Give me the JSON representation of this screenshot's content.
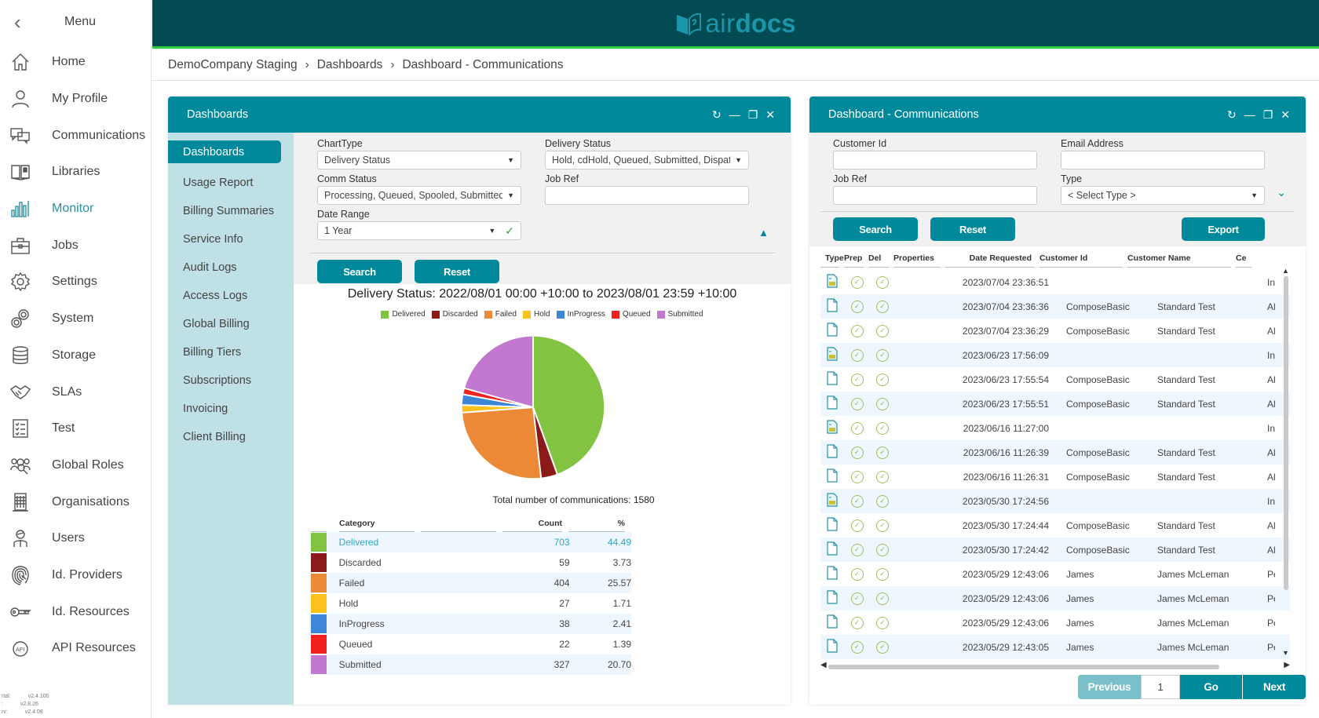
{
  "nav": {
    "menu_label": "Menu",
    "items": [
      {
        "label": "Home",
        "icon": "home-icon"
      },
      {
        "label": "My Profile",
        "icon": "profile-icon"
      },
      {
        "label": "Communications",
        "icon": "communications-icon"
      },
      {
        "label": "Libraries",
        "icon": "libraries-icon"
      },
      {
        "label": "Monitor",
        "icon": "monitor-icon",
        "active": true
      },
      {
        "label": "Jobs",
        "icon": "briefcase-icon"
      },
      {
        "label": "Settings",
        "icon": "gear-icon"
      },
      {
        "label": "System",
        "icon": "gears-icon"
      },
      {
        "label": "Storage",
        "icon": "database-icon"
      },
      {
        "label": "SLAs",
        "icon": "handshake-icon"
      },
      {
        "label": "Test",
        "icon": "checklist-icon"
      },
      {
        "label": "Global Roles",
        "icon": "roles-icon"
      },
      {
        "label": "Organisations",
        "icon": "building-icon"
      },
      {
        "label": "Users",
        "icon": "user-icon"
      },
      {
        "label": "Id. Providers",
        "icon": "fingerprint-icon"
      },
      {
        "label": "Id. Resources",
        "icon": "key-icon"
      },
      {
        "label": "API Resources",
        "icon": "api-icon"
      }
    ],
    "versions": [
      {
        "label": "rtal:",
        "value": "v2.4.100"
      },
      {
        "label": ":",
        "value": "v2.8.26"
      },
      {
        "label": "rv:",
        "value": "v2.4.08"
      }
    ]
  },
  "header": {
    "logo_part1": "air",
    "logo_part2": "docs",
    "brand_color": "#1a96ab",
    "bar_color": "#024b53",
    "accent_line": "#2ecc40"
  },
  "breadcrumb": [
    "DemoCompany Staging",
    "Dashboards",
    "Dashboard - Communications"
  ],
  "dashboards_panel": {
    "title": "Dashboards",
    "side_items": [
      "Dashboards",
      "Usage Report",
      "Billing Summaries",
      "Service Info",
      "Audit Logs",
      "Access Logs",
      "Global Billing",
      "Billing Tiers",
      "Subscriptions",
      "Invoicing",
      "Client Billing"
    ],
    "form": {
      "chart_type_label": "ChartType",
      "chart_type_value": "Delivery Status",
      "delivery_status_label": "Delivery Status",
      "delivery_status_value": "Hold, cdHold, Queued, Submitted, Dispatcl",
      "comm_status_label": "Comm Status",
      "comm_status_value": "Processing, Queued, Spooled, Submitted, H",
      "job_ref_label": "Job Ref",
      "job_ref_value": "",
      "date_range_label": "Date Range",
      "date_range_value": "1 Year"
    },
    "search_label": "Search",
    "reset_label": "Reset",
    "total_text": "Total number of communications: 1580",
    "table_headers": {
      "category": "Category",
      "count": "Count",
      "pct": "%"
    }
  },
  "chart_data": {
    "type": "pie",
    "title": "Delivery Status: 2022/08/01 00:00 +10:00 to 2023/08/01 23:59 +10:00",
    "legend_position": "top",
    "total": 1580,
    "slices": [
      {
        "label": "Delivered",
        "value": 703,
        "percent": 44.49,
        "color": "#82c341"
      },
      {
        "label": "Discarded",
        "value": 59,
        "percent": 3.73,
        "color": "#8b1a1a"
      },
      {
        "label": "Failed",
        "value": 404,
        "percent": 25.57,
        "color": "#ec8936"
      },
      {
        "label": "Hold",
        "value": 27,
        "percent": 1.71,
        "color": "#fcc21b"
      },
      {
        "label": "InProgress",
        "value": 38,
        "percent": 2.41,
        "color": "#3d85d6"
      },
      {
        "label": "Queued",
        "value": 22,
        "percent": 1.39,
        "color": "#f0211f"
      },
      {
        "label": "Submitted",
        "value": 327,
        "percent": 20.7,
        "color": "#c278cf"
      }
    ]
  },
  "comms_panel": {
    "title": "Dashboard - Communications",
    "form": {
      "customer_id_label": "Customer Id",
      "customer_id_value": "",
      "email_label": "Email Address",
      "email_value": "",
      "job_ref_label": "Job Ref",
      "job_ref_value": "",
      "type_label": "Type",
      "type_value": "< Select Type >"
    },
    "search_label": "Search",
    "reset_label": "Reset",
    "export_label": "Export",
    "columns": [
      "Type",
      "Prep",
      "Del",
      "Properties",
      "Date Requested",
      "Customer Id",
      "Customer Name",
      "Ce"
    ],
    "rows": [
      {
        "type": "spreadsheet",
        "date": "2023/07/04 23:36:51",
        "customer_id": "",
        "customer_name": "",
        "extra": "In"
      },
      {
        "type": "document",
        "date": "2023/07/04 23:36:36",
        "customer_id": "ComposeBasic",
        "customer_name": "Standard Test",
        "extra": "Al"
      },
      {
        "type": "document",
        "date": "2023/07/04 23:36:29",
        "customer_id": "ComposeBasic",
        "customer_name": "Standard Test",
        "extra": "Al"
      },
      {
        "type": "spreadsheet",
        "date": "2023/06/23 17:56:09",
        "customer_id": "",
        "customer_name": "",
        "extra": "In"
      },
      {
        "type": "document",
        "date": "2023/06/23 17:55:54",
        "customer_id": "ComposeBasic",
        "customer_name": "Standard Test",
        "extra": "Al"
      },
      {
        "type": "document",
        "date": "2023/06/23 17:55:51",
        "customer_id": "ComposeBasic",
        "customer_name": "Standard Test",
        "extra": "Al"
      },
      {
        "type": "spreadsheet",
        "date": "2023/06/16 11:27:00",
        "customer_id": "",
        "customer_name": "",
        "extra": "In"
      },
      {
        "type": "document",
        "date": "2023/06/16 11:26:39",
        "customer_id": "ComposeBasic",
        "customer_name": "Standard Test",
        "extra": "Al"
      },
      {
        "type": "document",
        "date": "2023/06/16 11:26:31",
        "customer_id": "ComposeBasic",
        "customer_name": "Standard Test",
        "extra": "Al"
      },
      {
        "type": "spreadsheet",
        "date": "2023/05/30 17:24:56",
        "customer_id": "",
        "customer_name": "",
        "extra": "In"
      },
      {
        "type": "document",
        "date": "2023/05/30 17:24:44",
        "customer_id": "ComposeBasic",
        "customer_name": "Standard Test",
        "extra": "Al"
      },
      {
        "type": "document",
        "date": "2023/05/30 17:24:42",
        "customer_id": "ComposeBasic",
        "customer_name": "Standard Test",
        "extra": "Al"
      },
      {
        "type": "document",
        "date": "2023/05/29 12:43:06",
        "customer_id": "James",
        "customer_name": "James McLeman",
        "extra": "Pe"
      },
      {
        "type": "document",
        "date": "2023/05/29 12:43:06",
        "customer_id": "James",
        "customer_name": "James McLeman",
        "extra": "Pe"
      },
      {
        "type": "document",
        "date": "2023/05/29 12:43:06",
        "customer_id": "James",
        "customer_name": "James McLeman",
        "extra": "Pe"
      },
      {
        "type": "document",
        "date": "2023/05/29 12:43:05",
        "customer_id": "James",
        "customer_name": "James McLeman",
        "extra": "Pe"
      }
    ],
    "pager": {
      "previous": "Previous",
      "page": "1",
      "go": "Go",
      "next": "Next"
    }
  }
}
